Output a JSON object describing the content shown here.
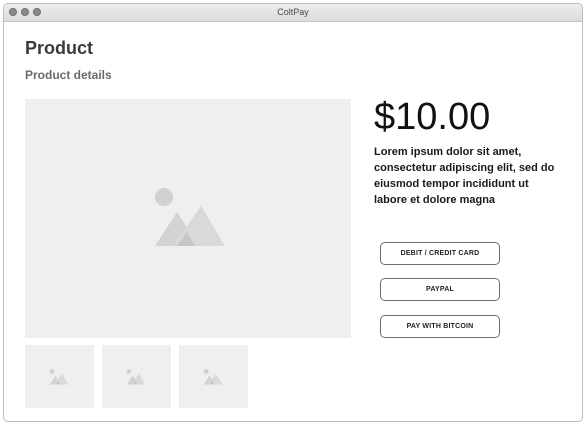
{
  "window": {
    "title": "ColtPay"
  },
  "product": {
    "title": "Product",
    "subtitle": "Product details",
    "price": "$10.00",
    "description": "Lorem ipsum dolor sit amet, consectetur adipiscing elit, sed do eiusmod tempor incididunt ut labore et dolore magna"
  },
  "payment": {
    "options": [
      {
        "label": "DEBIT / CREDIT CARD"
      },
      {
        "label": "PAYPAL"
      },
      {
        "label": "PAY WITH BITCOIN"
      }
    ]
  },
  "images": {
    "main_icon": "image-placeholder-icon",
    "thumbnail_icon": "image-placeholder-icon",
    "placeholder_color": "#efefef"
  }
}
